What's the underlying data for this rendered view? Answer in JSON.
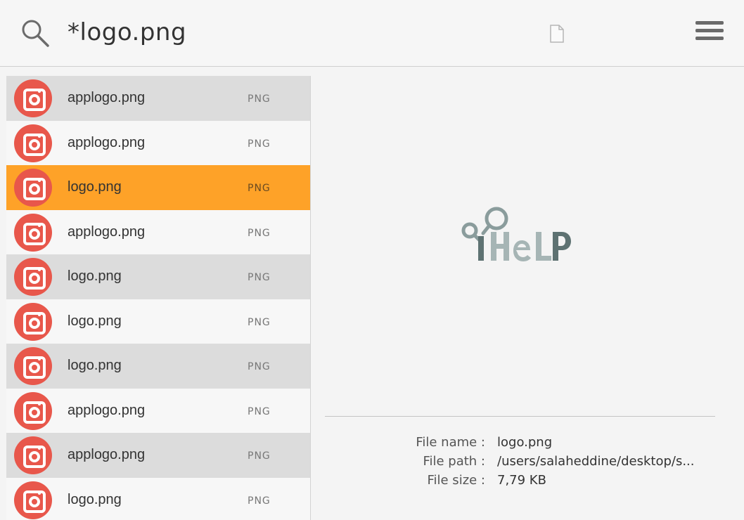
{
  "search": {
    "query": "*logo.png"
  },
  "results": [
    {
      "name": "applogo.png",
      "ext": "PNG",
      "state": "alt"
    },
    {
      "name": "applogo.png",
      "ext": "PNG",
      "state": "plain"
    },
    {
      "name": "logo.png",
      "ext": "PNG",
      "state": "selected"
    },
    {
      "name": "applogo.png",
      "ext": "PNG",
      "state": "plain"
    },
    {
      "name": "logo.png",
      "ext": "PNG",
      "state": "alt"
    },
    {
      "name": "logo.png",
      "ext": "PNG",
      "state": "plain"
    },
    {
      "name": "logo.png",
      "ext": "PNG",
      "state": "alt"
    },
    {
      "name": "applogo.png",
      "ext": "PNG",
      "state": "plain"
    },
    {
      "name": "applogo.png",
      "ext": "PNG",
      "state": "alt"
    },
    {
      "name": "logo.png",
      "ext": "PNG",
      "state": "plain"
    }
  ],
  "preview": {
    "logo_text": "iHelp",
    "labels": {
      "name": "File name :",
      "path": "File path :",
      "size": "File size :"
    },
    "file_name": "logo.png",
    "file_path": "/users/salaheddine/desktop/s...",
    "file_size": "7,79 KB"
  },
  "colors": {
    "selected": "#fea228",
    "icon_bg": "#e8574b",
    "logo_grey": "#8a9c9c"
  },
  "icons": {
    "search": "search-icon",
    "file": "file-icon",
    "menu": "menu-icon",
    "app": "camera-app-icon"
  }
}
